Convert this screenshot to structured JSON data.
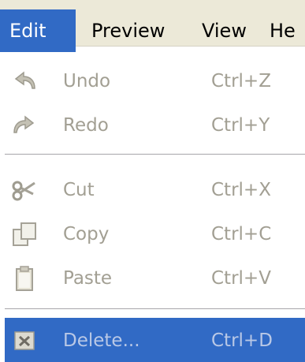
{
  "menubar": {
    "items": [
      {
        "label": "Edit",
        "active": true
      },
      {
        "label": "Preview",
        "active": false
      },
      {
        "label": "View",
        "active": false
      },
      {
        "label": "He",
        "active": false
      }
    ]
  },
  "menu": {
    "items": [
      {
        "icon": "undo-arrow-icon",
        "label": "Undo",
        "shortcut": "Ctrl+Z",
        "enabled": false
      },
      {
        "icon": "redo-arrow-icon",
        "label": "Redo",
        "shortcut": "Ctrl+Y",
        "enabled": false
      },
      {
        "icon": "scissors-icon",
        "label": "Cut",
        "shortcut": "Ctrl+X",
        "enabled": false
      },
      {
        "icon": "copy-pages-icon",
        "label": "Copy",
        "shortcut": "Ctrl+C",
        "enabled": false
      },
      {
        "icon": "clipboard-icon",
        "label": "Paste",
        "shortcut": "Ctrl+V",
        "enabled": false
      },
      {
        "icon": "delete-x-icon",
        "label": "Delete...",
        "shortcut": "Ctrl+D",
        "enabled": false,
        "highlighted": true
      }
    ]
  },
  "colors": {
    "menubar_bg": "#ece9d8",
    "highlight": "#316ac5",
    "disabled_text": "#a29f93",
    "highlight_disabled_text": "#b9c8e6"
  }
}
